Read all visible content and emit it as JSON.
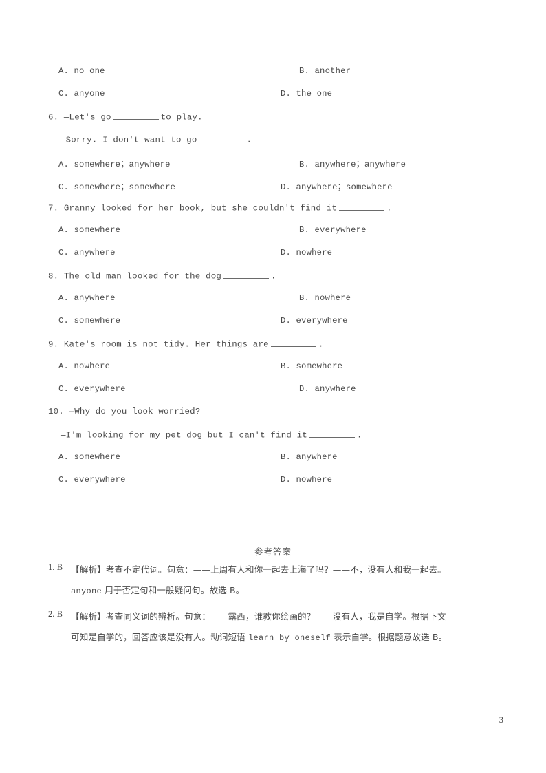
{
  "document": {
    "page_number": "3",
    "answers_heading": "参考答案"
  },
  "questions": [
    {
      "id": "q5-options",
      "number": "",
      "stems": [],
      "options": [
        {
          "label": "A.",
          "text": "no one",
          "pos": "A"
        },
        {
          "label": "B.",
          "text": "another",
          "pos": "B"
        },
        {
          "label": "C.",
          "text": "anyone",
          "pos": "C"
        },
        {
          "label": "D.",
          "text": "the one",
          "pos": "D"
        }
      ]
    },
    {
      "id": "q6",
      "number": "6.",
      "stem_line_1_pre": "—Let's go",
      "stem_line_1_post": "to play.",
      "stem_line_2_pre": "—Sorry. I don't want to go",
      "stem_line_2_post": ".",
      "options": [
        {
          "label": "A.",
          "text": "somewhere；anywhere"
        },
        {
          "label": "B.",
          "text": "anywhere；anywhere"
        },
        {
          "label": "C.",
          "text": "somewhere；somewhere"
        },
        {
          "label": "D.",
          "text": "anywhere；somewhere"
        }
      ]
    },
    {
      "id": "q7",
      "number": "7.",
      "stem_pre": "Granny looked for her book, but she couldn't find it",
      "stem_post": ".",
      "options": [
        {
          "label": "A.",
          "text": "somewhere"
        },
        {
          "label": "B.",
          "text": "everywhere"
        },
        {
          "label": "C.",
          "text": "anywhere"
        },
        {
          "label": "D.",
          "text": "nowhere"
        }
      ]
    },
    {
      "id": "q8",
      "number": "8.",
      "stem_pre": "The old man looked for the dog",
      "stem_post": ".",
      "options": [
        {
          "label": "A.",
          "text": "anywhere"
        },
        {
          "label": "B.",
          "text": "nowhere"
        },
        {
          "label": "C.",
          "text": "somewhere"
        },
        {
          "label": "D.",
          "text": "everywhere"
        }
      ]
    },
    {
      "id": "q9",
      "number": "9.",
      "stem_pre": "Kate's room is not tidy. Her things are",
      "stem_post": ".",
      "options": [
        {
          "label": "A.",
          "text": "nowhere"
        },
        {
          "label": "B.",
          "text": "somewhere"
        },
        {
          "label": "C.",
          "text": "everywhere"
        },
        {
          "label": "D.",
          "text": "anywhere"
        }
      ]
    },
    {
      "id": "q10",
      "number": "10.",
      "stem_line_1": "—Why do you look worried?",
      "stem_line_2_pre": "—I'm looking for my pet dog but I can't find it",
      "stem_line_2_post": ".",
      "options": [
        {
          "label": "A.",
          "text": "somewhere"
        },
        {
          "label": "B.",
          "text": "anywhere"
        },
        {
          "label": "C.",
          "text": "everywhere"
        },
        {
          "label": "D.",
          "text": "nowhere"
        }
      ]
    }
  ],
  "answers": [
    {
      "key": "1. B",
      "line1": "【解析】考查不定代词。句意：——上周有人和你一起去上海了吗？——不，没有人和我一起去。",
      "line2_mono": "anyone",
      "line2_rest": "用于否定句和一般疑问句。故选 B。"
    },
    {
      "key": "2. B",
      "line1": "【解析】考查同义词的辨析。句意：——露西，谁教你绘画的？——没有人，我是自学。根据下文",
      "line2_a": "可知是自学的，回答应该是没有人。动词短语",
      "line2_mono": "learn by oneself",
      "line2_b": "表示自学。根据题意故选 B。"
    }
  ]
}
